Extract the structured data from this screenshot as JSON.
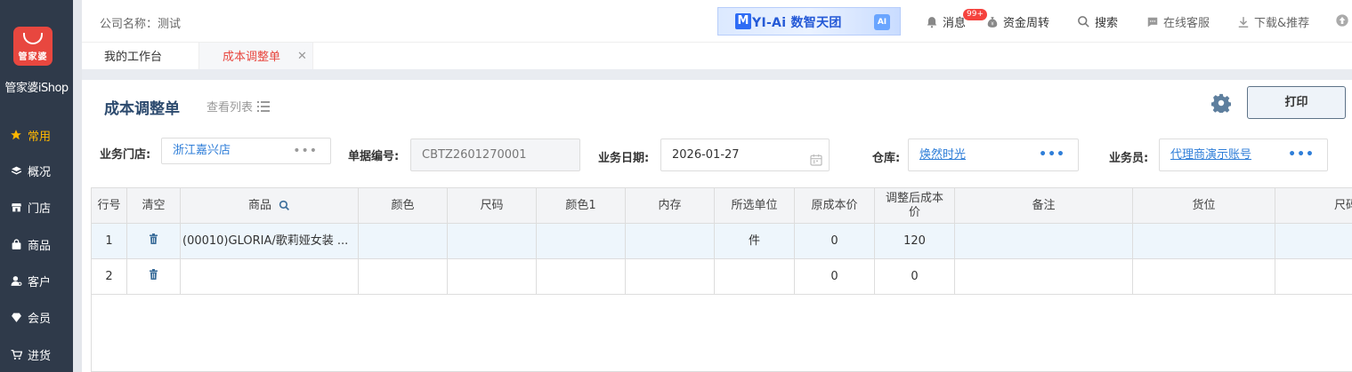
{
  "sidebar": {
    "logo_text": "管家婆",
    "app_name": "管家婆iShop",
    "items": [
      {
        "label": "常用",
        "icon": "star-icon",
        "active": true
      },
      {
        "label": "概况",
        "icon": "layers-icon"
      },
      {
        "label": "门店",
        "icon": "store-icon"
      },
      {
        "label": "商品",
        "icon": "bag-icon"
      },
      {
        "label": "客户",
        "icon": "customer-icon"
      },
      {
        "label": "会员",
        "icon": "diamond-icon"
      },
      {
        "label": "进货",
        "icon": "cart-icon"
      }
    ]
  },
  "header": {
    "company": "公司名称：测试",
    "banner": {
      "mark": "M",
      "text": "YI-Ai 数智天团",
      "ai": "AI"
    },
    "messages": {
      "label": "消息",
      "badge": "99+"
    },
    "funds": "资金周转",
    "search": "搜索",
    "service": "在线客服",
    "download": "下载&推荐"
  },
  "tabs": [
    {
      "label": "我的工作台"
    },
    {
      "label": "成本调整单",
      "active": true
    }
  ],
  "page": {
    "title": "成本调整单",
    "view_list": "查看列表",
    "print": "打印"
  },
  "form": {
    "store_label": "业务门店:",
    "store_value": "浙江嘉兴店",
    "bill_no_label": "单据编号:",
    "bill_no_value": "CBTZ2601270001",
    "date_label": "业务日期:",
    "date_value": "2026-01-27",
    "warehouse_label": "仓库:",
    "warehouse_value": "焕然时光",
    "staff_label": "业务员:",
    "staff_value": "代理商演示账号"
  },
  "table": {
    "headers": [
      "行号",
      "清空",
      "商品",
      "颜色",
      "尺码",
      "颜色1",
      "内存",
      "所选单位",
      "原成本价",
      "调整后成本价",
      "备注",
      "货位",
      "尺码"
    ],
    "rows": [
      {
        "no": "1",
        "product": "(00010)GLORIA/歌莉娅女装 ...",
        "unit": "件",
        "orig_cost": "0",
        "adj_cost": "120"
      },
      {
        "no": "2",
        "product": "",
        "unit": "",
        "orig_cost": "0",
        "adj_cost": "0"
      }
    ]
  },
  "colors": {
    "sidebar_bg": "#2f3a4a",
    "active_nav": "#ffb800",
    "brand_red": "#e8473f",
    "link_blue": "#2f7ed8"
  }
}
